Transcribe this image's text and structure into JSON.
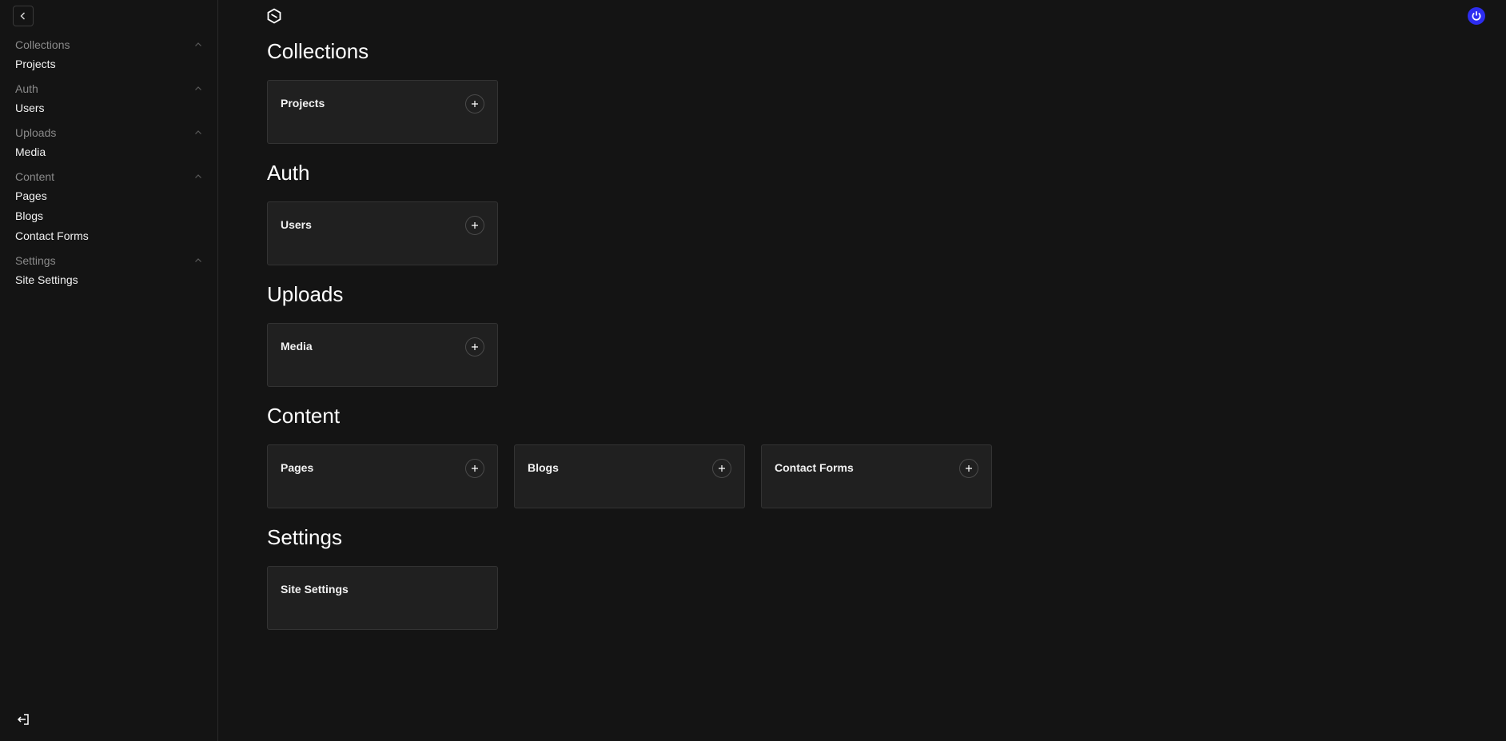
{
  "sidebar": {
    "groups": [
      {
        "label": "Collections",
        "items": [
          {
            "label": "Projects"
          }
        ]
      },
      {
        "label": "Auth",
        "items": [
          {
            "label": "Users"
          }
        ]
      },
      {
        "label": "Uploads",
        "items": [
          {
            "label": "Media"
          }
        ]
      },
      {
        "label": "Content",
        "items": [
          {
            "label": "Pages"
          },
          {
            "label": "Blogs"
          },
          {
            "label": "Contact Forms"
          }
        ]
      },
      {
        "label": "Settings",
        "items": [
          {
            "label": "Site Settings"
          }
        ]
      }
    ],
    "collapse_icon": "chevron-left-icon",
    "logout_icon": "logout-icon"
  },
  "header": {
    "logo_icon": "payload-logo-icon",
    "avatar_icon": "power-icon",
    "avatar_color": "#2d2df0"
  },
  "sections": [
    {
      "title": "Collections",
      "cards": [
        {
          "label": "Projects",
          "has_add": true
        }
      ]
    },
    {
      "title": "Auth",
      "cards": [
        {
          "label": "Users",
          "has_add": true
        }
      ]
    },
    {
      "title": "Uploads",
      "cards": [
        {
          "label": "Media",
          "has_add": true
        }
      ]
    },
    {
      "title": "Content",
      "cards": [
        {
          "label": "Pages",
          "has_add": true
        },
        {
          "label": "Blogs",
          "has_add": true
        },
        {
          "label": "Contact Forms",
          "has_add": true
        }
      ]
    },
    {
      "title": "Settings",
      "cards": [
        {
          "label": "Site Settings",
          "has_add": false
        }
      ]
    }
  ],
  "colors": {
    "background": "#141414",
    "card": "#202020",
    "muted_text": "#8a8a8a",
    "accent": "#2d2df0"
  }
}
